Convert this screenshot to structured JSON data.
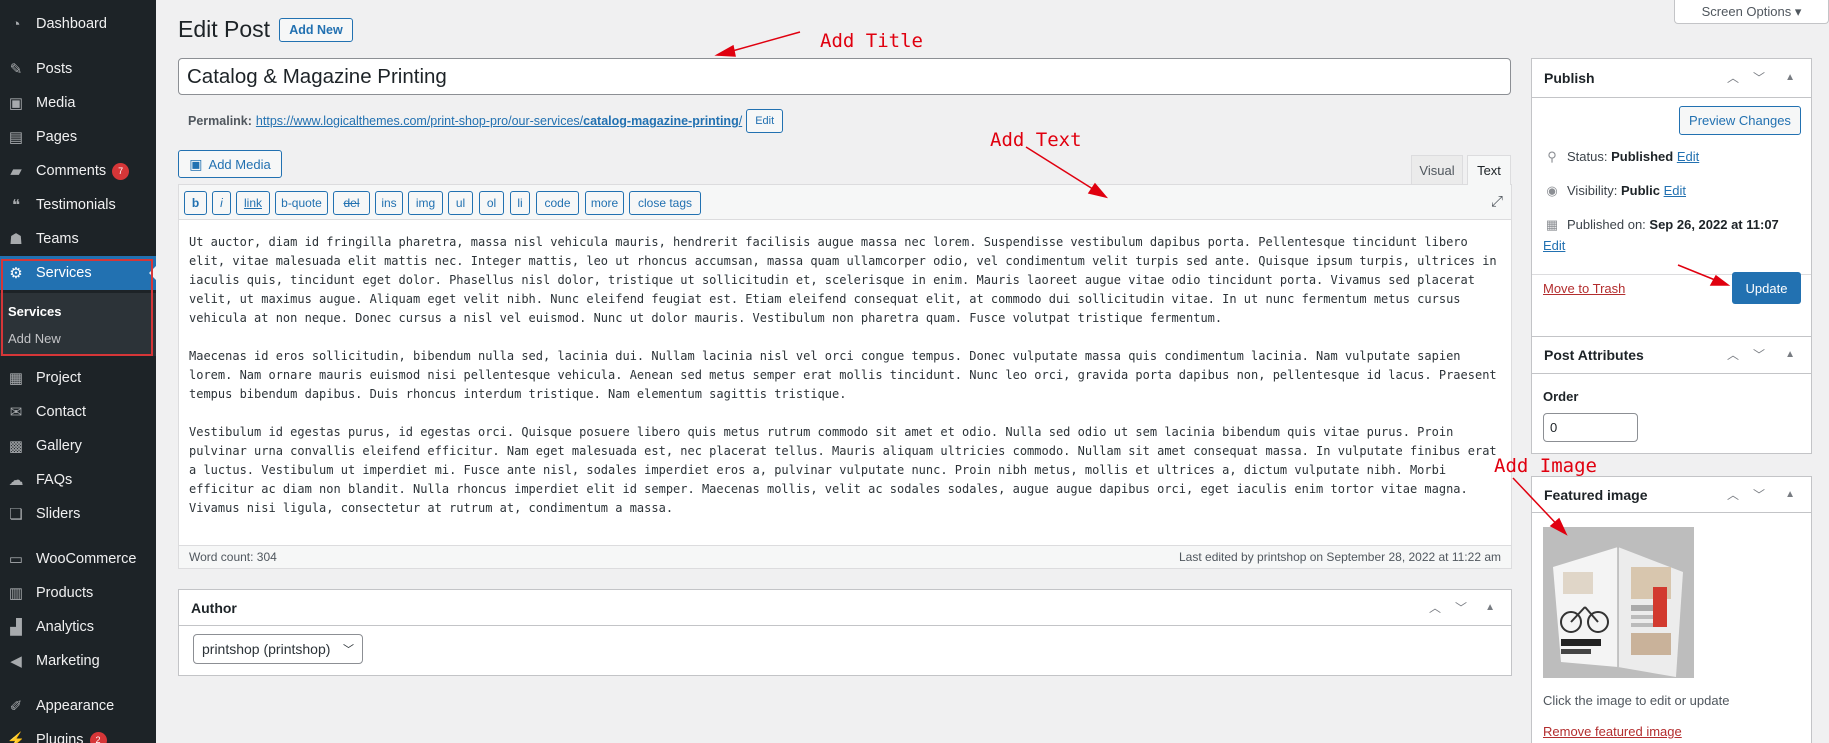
{
  "sidebar": {
    "items": [
      {
        "label": "Dashboard",
        "icon": "dashboard-icon"
      },
      {
        "label": "Posts",
        "icon": "pin-icon"
      },
      {
        "label": "Media",
        "icon": "media-icon"
      },
      {
        "label": "Pages",
        "icon": "pages-icon"
      },
      {
        "label": "Comments",
        "icon": "comments-icon",
        "badge": "7"
      },
      {
        "label": "Testimonials",
        "icon": "testimonials-icon"
      },
      {
        "label": "Teams",
        "icon": "teams-icon"
      },
      {
        "label": "Services",
        "icon": "services-icon"
      },
      {
        "label": "Project",
        "icon": "project-icon"
      },
      {
        "label": "Contact",
        "icon": "contact-icon"
      },
      {
        "label": "Gallery",
        "icon": "gallery-icon"
      },
      {
        "label": "FAQs",
        "icon": "faqs-icon"
      },
      {
        "label": "Sliders",
        "icon": "sliders-icon"
      },
      {
        "label": "WooCommerce",
        "icon": "woocommerce-icon"
      },
      {
        "label": "Products",
        "icon": "products-icon"
      },
      {
        "label": "Analytics",
        "icon": "analytics-icon"
      },
      {
        "label": "Marketing",
        "icon": "marketing-icon"
      },
      {
        "label": "Appearance",
        "icon": "appearance-icon"
      },
      {
        "label": "Plugins",
        "icon": "plugins-icon",
        "badge": "2"
      }
    ],
    "submenu": {
      "current": "Services",
      "add_new": "Add New"
    }
  },
  "header": {
    "screen_options": "Screen Options ▾",
    "page_title": "Edit Post",
    "add_new": "Add New"
  },
  "post": {
    "title": "Catalog & Magazine Printing",
    "permalink_label": "Permalink:",
    "permalink_base": "https://www.logicalthemes.com/print-shop-pro/our-services/",
    "permalink_slug": "catalog-magazine-printing",
    "permalink_tail": "/",
    "permalink_edit": "Edit"
  },
  "editor": {
    "add_media": "Add Media",
    "tab_visual": "Visual",
    "tab_text": "Text",
    "toolbar": [
      "b",
      "i",
      "link",
      "b-quote",
      "del",
      "ins",
      "img",
      "ul",
      "ol",
      "li",
      "code",
      "more",
      "close tags"
    ],
    "paragraphs": [
      "Ut auctor, diam id fringilla pharetra, massa nisl vehicula mauris, hendrerit facilisis augue massa nec lorem. Suspendisse vestibulum dapibus porta. Pellentesque tincidunt libero elit, vitae malesuada elit mattis nec. Integer mattis, leo ut rhoncus accumsan, massa quam ullamcorper odio, vel condimentum velit turpis sed ante. Quisque ipsum turpis, ultrices in iaculis quis, tincidunt eget dolor. Phasellus nisl dolor, tristique ut sollicitudin et, scelerisque in enim. Mauris laoreet augue vitae odio tincidunt porta. Vivamus sed placerat velit, ut maximus augue. Aliquam eget velit nibh. Nunc eleifend feugiat est. Etiam eleifend consequat elit, at commodo dui sollicitudin vitae. In ut nunc fermentum metus cursus vehicula at non neque. Donec cursus a nisl vel euismod. Nunc ut dolor mauris. Vestibulum non pharetra quam. Fusce volutpat tristique fermentum.",
      "Maecenas id eros sollicitudin, bibendum nulla sed, lacinia dui. Nullam lacinia nisl vel orci congue tempus. Donec vulputate massa quis condimentum lacinia. Nam vulputate sapien lorem. Nam ornare mauris euismod nisi pellentesque vehicula. Aenean sed metus semper erat mollis tincidunt. Nunc leo orci, gravida porta dapibus non, pellentesque id lacus. Praesent tempus bibendum dapibus. Duis rhoncus interdum tristique. Nam elementum sagittis tristique.",
      "Vestibulum id egestas purus, id egestas orci. Quisque posuere libero quis metus rutrum commodo sit amet et odio. Nulla sed odio ut sem lacinia bibendum quis vitae purus. Proin pulvinar urna convallis eleifend efficitur. Nam eget malesuada est, nec placerat tellus. Mauris aliquam ultricies commodo. Nullam sit amet consequat massa. In vulputate finibus erat a luctus. Vestibulum ut imperdiet mi. Fusce ante nisl, sodales imperdiet eros a, pulvinar vulputate nunc. Proin nibh metus, mollis et ultrices a, dictum vulputate nibh. Morbi efficitur ac diam non blandit. Nulla rhoncus imperdiet elit id semper. Maecenas mollis, velit ac sodales sodales, augue augue dapibus orci, eget iaculis enim tortor vitae magna. Vivamus nisi ligula, consectetur at rutrum at, condimentum a massa."
    ],
    "word_count": "Word count: 304",
    "last_edited": "Last edited by printshop on September 28, 2022 at 11:22 am"
  },
  "author": {
    "title": "Author",
    "selected": "printshop (printshop)"
  },
  "publish": {
    "title": "Publish",
    "preview": "Preview Changes",
    "status_label": "Status:",
    "status_value": "Published",
    "visibility_label": "Visibility:",
    "visibility_value": "Public",
    "published_label": "Published on:",
    "published_value": "Sep 26, 2022 at 11:07",
    "edit": "Edit",
    "trash": "Move to Trash",
    "update": "Update"
  },
  "attributes": {
    "title": "Post Attributes",
    "order_label": "Order",
    "order_value": "0"
  },
  "featured": {
    "title": "Featured image",
    "hint": "Click the image to edit or update",
    "remove": "Remove featured image"
  },
  "annotations": {
    "title": "Add Title",
    "text": "Add Text",
    "image": "Add Image",
    "color": "#e0000f"
  }
}
